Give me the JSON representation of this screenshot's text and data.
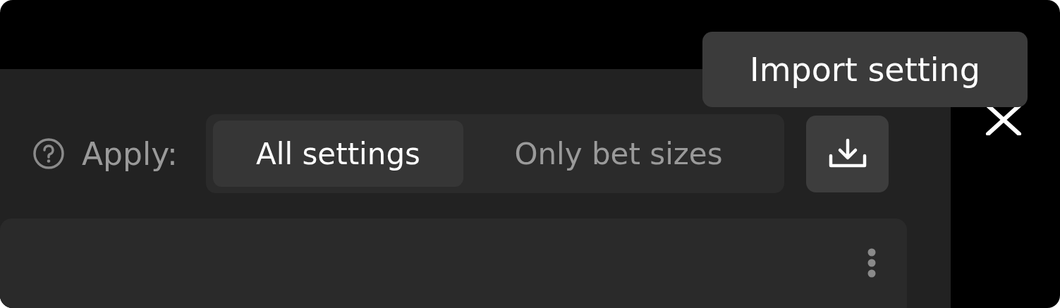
{
  "tooltip": {
    "text": "Import setting"
  },
  "apply": {
    "label": "Apply:",
    "options": [
      {
        "label": "All settings",
        "selected": true
      },
      {
        "label": "Only bet sizes",
        "selected": false
      }
    ]
  }
}
